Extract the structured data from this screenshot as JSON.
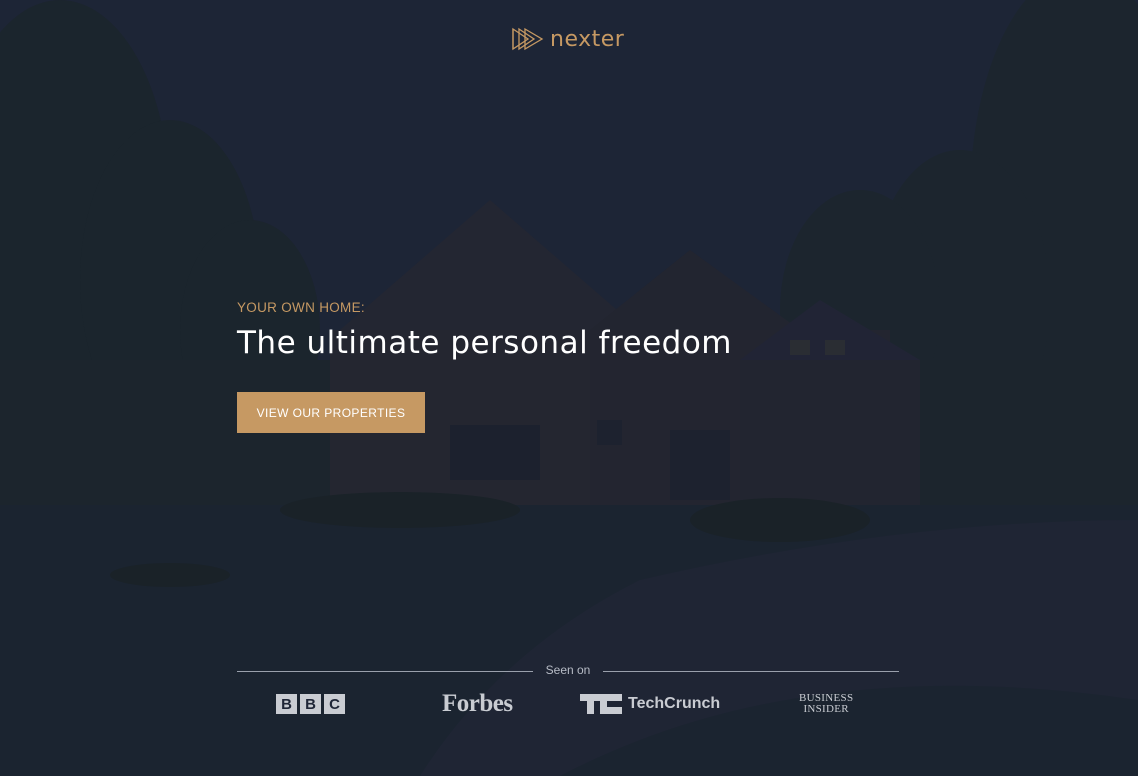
{
  "brand": {
    "name": "nexter",
    "accent_color": "#c69963"
  },
  "hero": {
    "eyebrow": "YOUR OWN HOME:",
    "headline": "The ultimate personal freedom",
    "cta_label": "VIEW OUR PROPERTIES"
  },
  "seen_on": {
    "label": "Seen on",
    "logos": {
      "bbc": [
        "B",
        "B",
        "C"
      ],
      "forbes": "Forbes",
      "techcrunch": "TechCrunch",
      "business_insider": [
        "BUSINESS",
        "INSIDER"
      ]
    }
  },
  "icons": {
    "logo_mark": "triple-play-arrow-icon",
    "techcrunch_mark": "tc-icon"
  }
}
